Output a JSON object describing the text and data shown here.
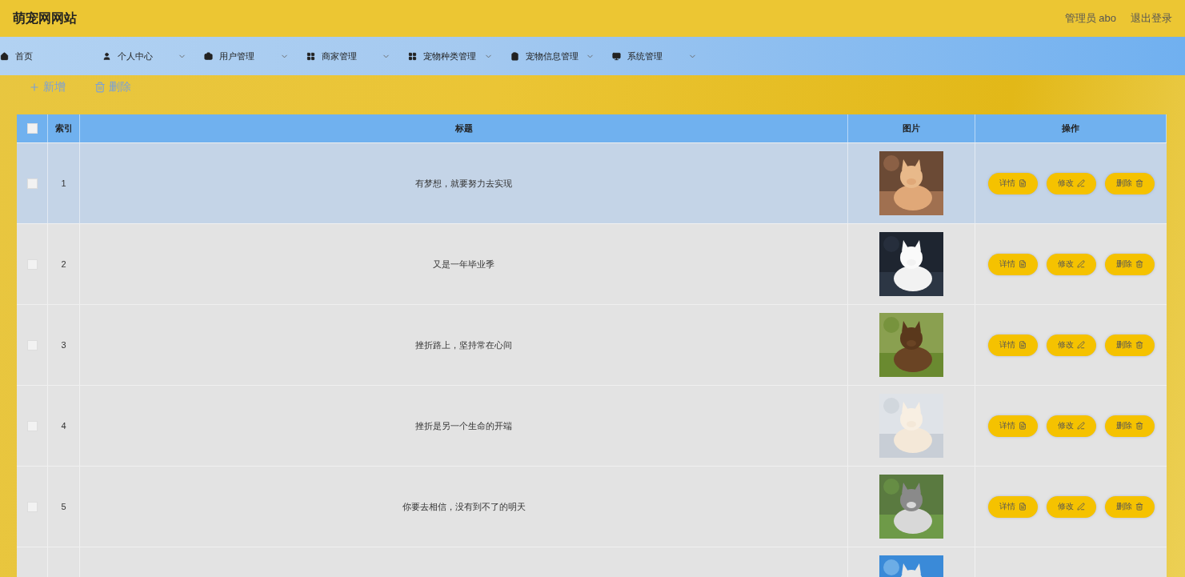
{
  "site_title": "萌宠网网站",
  "user": {
    "role": "管理员 abo",
    "logout": "退出登录"
  },
  "nav": [
    {
      "label": "首页",
      "has_menu": false
    },
    {
      "label": "个人中心",
      "has_menu": true
    },
    {
      "label": "用户管理",
      "has_menu": true
    },
    {
      "label": "商家管理",
      "has_menu": true
    },
    {
      "label": "宠物种类管理",
      "has_menu": true
    },
    {
      "label": "宠物信息管理",
      "has_menu": true
    },
    {
      "label": "系统管理",
      "has_menu": true
    }
  ],
  "toolbar": [
    {
      "label": "新增",
      "kind": "add"
    },
    {
      "label": "删除",
      "kind": "delete"
    }
  ],
  "table": {
    "header_checkbox": {
      "checked": false
    },
    "columns": [
      "索引",
      "标题",
      "图片",
      "操作"
    ],
    "rows": [
      {
        "checked": false,
        "selected": true,
        "index": "1",
        "title": "有梦想，就要努力去实现",
        "image": {
          "kind": "picture"
        },
        "actions": [
          {
            "label": "详情",
            "kind": "detail"
          },
          {
            "label": "修改",
            "kind": "edit"
          },
          {
            "label": "删除",
            "kind": "delete"
          }
        ]
      },
      {
        "checked": false,
        "selected": false,
        "index": "2",
        "title": "又是一年毕业季",
        "image": {
          "kind": "picture"
        },
        "actions": [
          {
            "label": "详情",
            "kind": "detail"
          },
          {
            "label": "修改",
            "kind": "edit"
          },
          {
            "label": "删除",
            "kind": "delete"
          }
        ]
      },
      {
        "checked": false,
        "selected": false,
        "index": "3",
        "title": "挫折路上，坚持常在心间",
        "image": {
          "kind": "picture"
        },
        "actions": [
          {
            "label": "详情",
            "kind": "detail"
          },
          {
            "label": "修改",
            "kind": "edit"
          },
          {
            "label": "删除",
            "kind": "delete"
          }
        ]
      },
      {
        "checked": false,
        "selected": false,
        "index": "4",
        "title": "挫折是另一个生命的开端",
        "image": {
          "kind": "picture"
        },
        "actions": [
          {
            "label": "详情",
            "kind": "detail"
          },
          {
            "label": "修改",
            "kind": "edit"
          },
          {
            "label": "删除",
            "kind": "delete"
          }
        ]
      },
      {
        "checked": false,
        "selected": false,
        "index": "5",
        "title": "你要去相信，没有到不了的明天",
        "image": {
          "kind": "picture"
        },
        "actions": [
          {
            "label": "详情",
            "kind": "detail"
          },
          {
            "label": "修改",
            "kind": "edit"
          },
          {
            "label": "删除",
            "kind": "delete"
          }
        ]
      },
      {
        "selected": false,
        "image": {
          "kind": "picture"
        }
      }
    ]
  }
}
